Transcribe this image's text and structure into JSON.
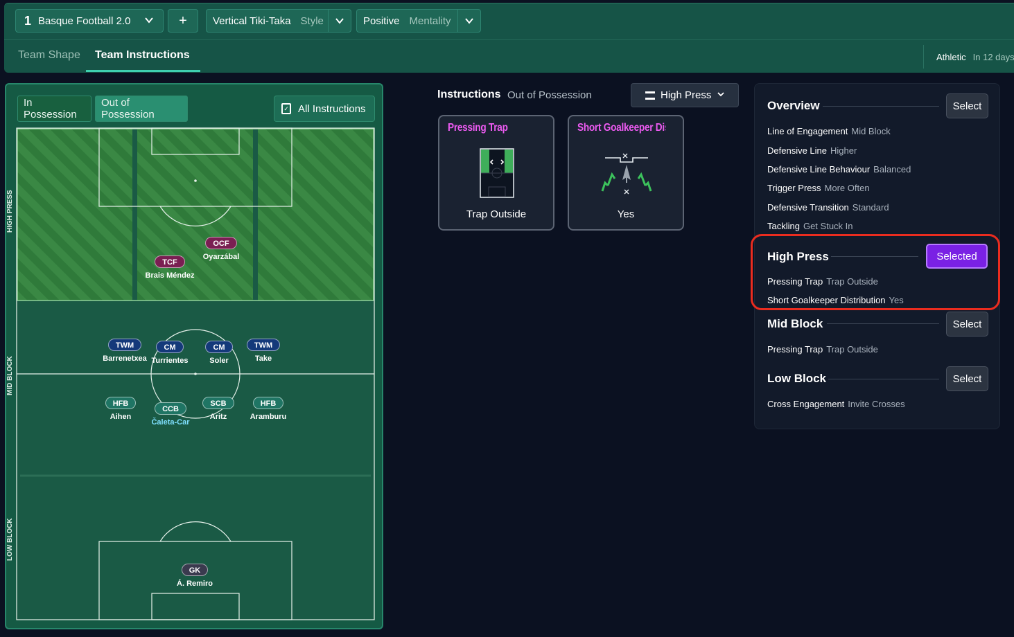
{
  "topbar": {
    "tactic_number": "1",
    "tactic_name": "Basque Football 2.0",
    "add_label": "+",
    "style_value": "Vertical Tiki-Taka",
    "style_label": "Style",
    "mentality_value": "Positive",
    "mentality_label": "Mentality",
    "tabs": [
      {
        "label": "Team Shape"
      },
      {
        "label": "Team Instructions"
      }
    ],
    "next_opponent": "Athletic",
    "next_match_in": "In 12 days"
  },
  "left_panel": {
    "in_possession": "In Possession",
    "out_of_possession": "Out of Possession",
    "all_instructions": "All Instructions",
    "zones": {
      "high": "HIGH PRESS",
      "mid": "MID BLOCK",
      "low": "LOW BLOCK"
    },
    "players": [
      {
        "pos": "OCF",
        "name": "Oyarzábal",
        "role": "att"
      },
      {
        "pos": "TCF",
        "name": "Brais Méndez",
        "role": "att"
      },
      {
        "pos": "TWM",
        "name": "Barrenetxea",
        "role": "mid"
      },
      {
        "pos": "CM",
        "name": "Turrientes",
        "role": "mid"
      },
      {
        "pos": "CM",
        "name": "Soler",
        "role": "mid"
      },
      {
        "pos": "TWM",
        "name": "Take",
        "role": "mid"
      },
      {
        "pos": "HFB",
        "name": "Aihen",
        "role": "def"
      },
      {
        "pos": "CCB",
        "name": "Čaleta-Car",
        "role": "def"
      },
      {
        "pos": "SCB",
        "name": "Aritz",
        "role": "def"
      },
      {
        "pos": "HFB",
        "name": "Aramburu",
        "role": "def"
      },
      {
        "pos": "GK",
        "name": "Á. Remiro",
        "role": "gk"
      }
    ]
  },
  "instructions": {
    "title": "Instructions",
    "subtitle": "Out of Possession",
    "phase_dropdown": "High Press",
    "cards": [
      {
        "title": "Pressing Trap",
        "value": "Trap Outside"
      },
      {
        "title": "Short Goalkeeper Distr",
        "value": "Yes"
      }
    ]
  },
  "overview": {
    "title": "Overview",
    "select_label": "Select",
    "rows": [
      {
        "label": "Line of Engagement",
        "value": "Mid Block"
      },
      {
        "label": "Defensive Line",
        "value": "Higher"
      },
      {
        "label": "Defensive Line Behaviour",
        "value": "Balanced"
      },
      {
        "label": "Trigger Press",
        "value": "More Often"
      },
      {
        "label": "Defensive Transition",
        "value": "Standard"
      },
      {
        "label": "Tackling",
        "value": "Get Stuck In"
      }
    ],
    "high_press": {
      "title": "High Press",
      "button": "Selected",
      "rows": [
        {
          "label": "Pressing Trap",
          "value": "Trap Outside"
        },
        {
          "label": "Short Goalkeeper Distribution",
          "value": "Yes"
        }
      ]
    },
    "mid_block": {
      "title": "Mid Block",
      "button": "Select",
      "rows": [
        {
          "label": "Pressing Trap",
          "value": "Trap Outside"
        }
      ]
    },
    "low_block": {
      "title": "Low Block",
      "button": "Select",
      "rows": [
        {
          "label": "Cross Engagement",
          "value": "Invite Crosses"
        }
      ]
    }
  },
  "colors": {
    "accent_teal": "#165447",
    "selected_purple": "#7a21e4",
    "highlight_red": "#ea2c1f",
    "card_title_pink": "#ee5bf2"
  }
}
